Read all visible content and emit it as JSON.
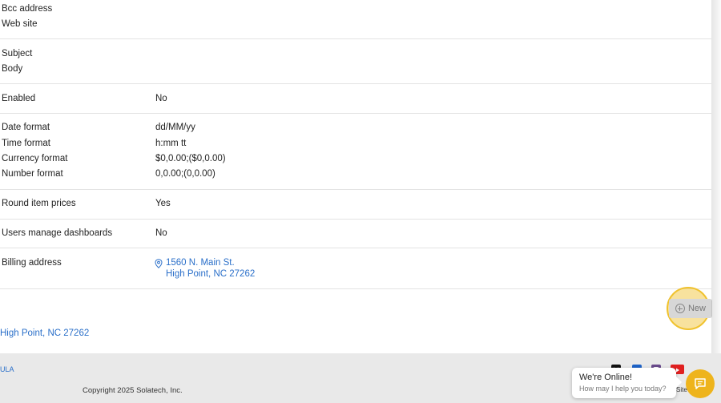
{
  "fields": [
    {
      "label": "Bcc address",
      "value": ""
    },
    {
      "label": "Web site",
      "value": ""
    },
    {
      "label": "Subject",
      "value": ""
    },
    {
      "label": "Body",
      "value": ""
    },
    {
      "label": "Enabled",
      "value": "No"
    },
    {
      "label": "Date format",
      "value": "dd/MM/yy"
    },
    {
      "label": "Time format",
      "value": "h:mm tt"
    },
    {
      "label": "Currency format",
      "value": "$0,0.00;($0,0.00)"
    },
    {
      "label": "Number format",
      "value": "0,0.00;(0,0.00)"
    },
    {
      "label": "Round item prices",
      "value": "Yes"
    },
    {
      "label": "Users manage dashboards",
      "value": "No"
    }
  ],
  "billing": {
    "label": "Billing address",
    "street": "1560 N. Main St.",
    "city": "High Point, NC 27262"
  },
  "new_button": {
    "label": "New"
  },
  "below_city": "High Point, NC 27262",
  "footer": {
    "eula": "ULA",
    "copyright": "Copyright 2025 Solatech, Inc.",
    "site_fragment": "Site"
  },
  "chat": {
    "title": "We're Online!",
    "subtitle": "How may I help you today?"
  },
  "colors": {
    "link": "#2a6fc9",
    "accent": "#eeb41c"
  },
  "icons": [
    "map-pin-icon",
    "plus-circle-icon",
    "x-twitter-icon",
    "facebook-icon",
    "instagram-icon",
    "youtube-icon",
    "chat-icon"
  ]
}
